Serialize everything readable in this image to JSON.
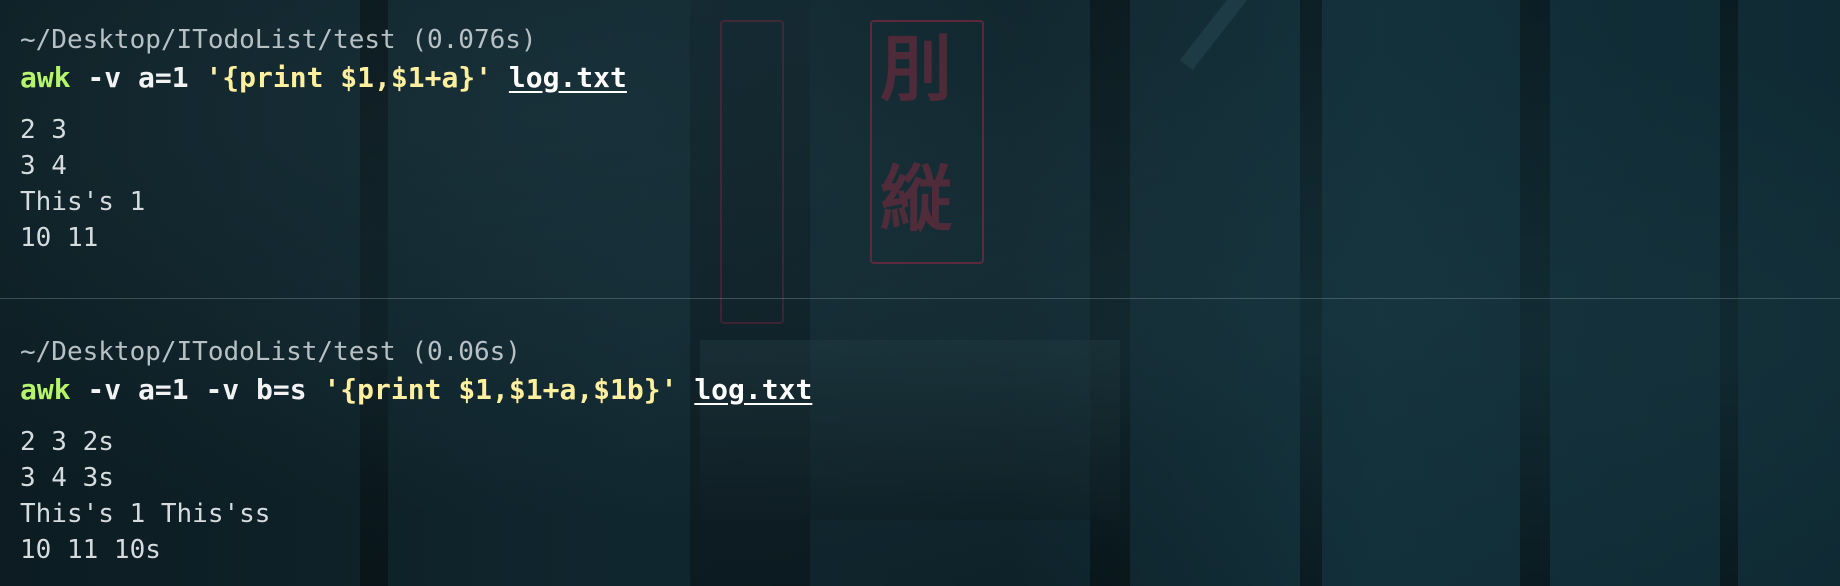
{
  "blocks": [
    {
      "path": "~/Desktop/ITodoList/test",
      "duration": "(0.076s)",
      "command": {
        "program": "awk",
        "args": " -v a=1 ",
        "script": "'{print $1,$1+a}'",
        "file": "log.txt"
      },
      "output": [
        "2 3",
        "3 4",
        "This's 1",
        "10 11"
      ]
    },
    {
      "path": "~/Desktop/ITodoList/test",
      "duration": "(0.06s)",
      "command": {
        "program": "awk",
        "args": " -v a=1 -v b=s ",
        "script": "'{print $1,$1+a,$1b}'",
        "file": "log.txt"
      },
      "output": [
        "2 3 2s",
        "3 4 3s",
        "This's 1 This'ss",
        "10 11 10s"
      ]
    }
  ],
  "colors": {
    "program": "#b6f46a",
    "script": "#ffef9e",
    "path": "#b7c0c3",
    "output": "#d6dcde"
  }
}
